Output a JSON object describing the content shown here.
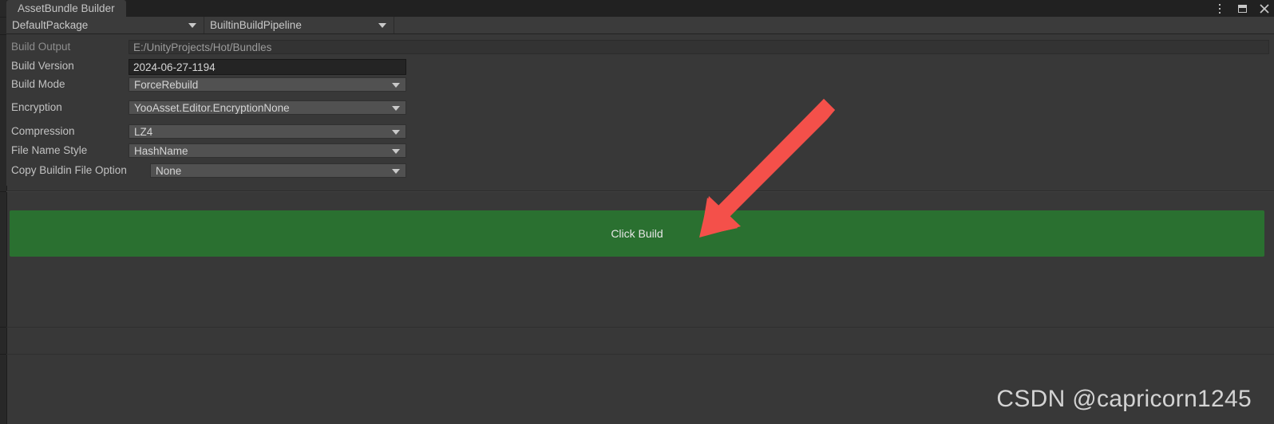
{
  "window": {
    "tab_label": "AssetBundle Builder",
    "controls": {
      "menu_label": "⋮",
      "maximize_label": "",
      "close_label": "✕"
    }
  },
  "toolbar": {
    "package": "DefaultPackage",
    "pipeline": "BuiltinBuildPipeline"
  },
  "form": {
    "rows": [
      {
        "label": "Build Output",
        "value": "E:/UnityProjects/Hot/Bundles",
        "kind": "readonly"
      },
      {
        "label": "Build Version",
        "value": "2024-06-27-1194",
        "kind": "text"
      },
      {
        "label": "Build Mode",
        "value": "ForceRebuild",
        "kind": "dropdown"
      },
      {
        "label": "Encryption",
        "value": "YooAsset.Editor.EncryptionNone",
        "kind": "dropdown"
      },
      {
        "label": "Compression",
        "value": "LZ4",
        "kind": "dropdown"
      },
      {
        "label": "File Name Style",
        "value": "HashName",
        "kind": "dropdown"
      },
      {
        "label": "Copy Buildin File Option",
        "value": "None",
        "kind": "dropdown"
      }
    ]
  },
  "build": {
    "button_label": "Click Build"
  },
  "annotation": {
    "arrow_color": "#f4504a",
    "points_to": "Click Build"
  },
  "background": {
    "clipped_text_fragment": "i"
  },
  "watermark": {
    "text": "CSDN @capricorn1245"
  },
  "colors": {
    "panel_bg": "#383838",
    "tabbar_bg": "#212121",
    "tab_active_bg": "#3b3b3b",
    "dropdown_bg": "#515151",
    "textfield_bg": "#242424",
    "readonly_bg": "#333333",
    "build_green": "#2a7030",
    "arrow_red": "#f4504a",
    "label_text": "#c2c2c2",
    "dim_text": "#8d8d8d"
  }
}
